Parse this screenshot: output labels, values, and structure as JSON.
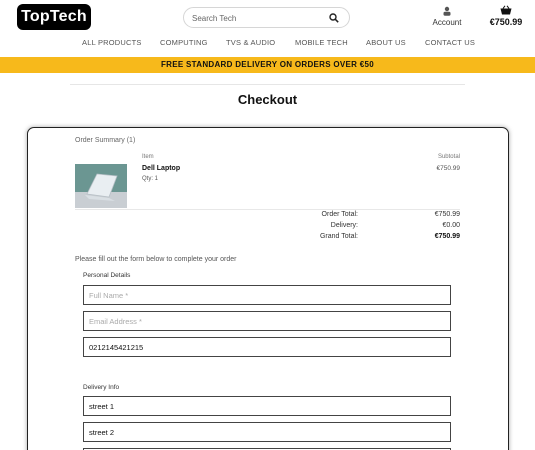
{
  "header": {
    "logo": "TopTech",
    "search_placeholder": "Search Tech",
    "account_label": "Account",
    "basket_total": "€750.99"
  },
  "nav": [
    "ALL PRODUCTS",
    "COMPUTING",
    "TVS & AUDIO",
    "MOBILE TECH",
    "ABOUT US",
    "CONTACT US"
  ],
  "banner": "FREE STANDARD DELIVERY ON ORDERS OVER €50",
  "page_title": "Checkout",
  "order_summary": {
    "title": "Order Summary (1)",
    "col_item": "Item",
    "col_subtotal": "Subtotal",
    "items": [
      {
        "name": "Dell Laptop",
        "qty": "Qty: 1",
        "subtotal": "€750.99"
      }
    ],
    "totals": [
      {
        "label": "Order Total:",
        "value": "€750.99"
      },
      {
        "label": "Delivery:",
        "value": "€0.00"
      },
      {
        "label": "Grand Total:",
        "value": "€750.99"
      }
    ]
  },
  "form": {
    "intro": "Please fill out the form below to complete your order",
    "personal_label": "Personal Details",
    "full_name_placeholder": "Full Name *",
    "email_placeholder": "Email Address *",
    "phone_value": "0212145421215",
    "delivery_label": "Delivery Info",
    "street1_value": "street 1",
    "street2_value": "street 2"
  },
  "colors": {
    "banner": "#f7b91b",
    "logo_bg": "#000000",
    "card_border": "#222222"
  },
  "icons": {
    "search": "search-icon",
    "account": "user-icon",
    "basket": "basket-icon"
  }
}
